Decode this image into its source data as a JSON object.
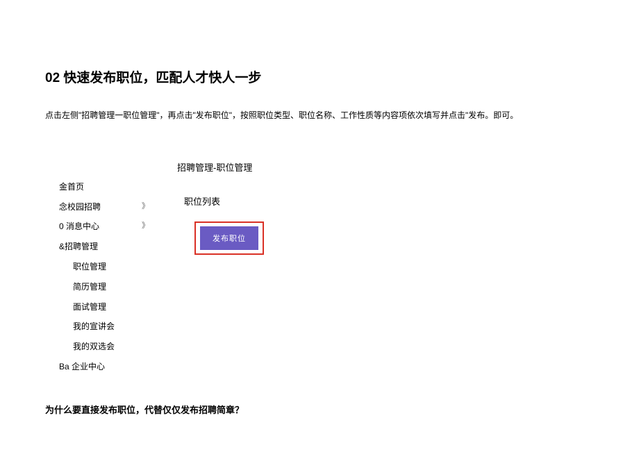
{
  "heading": {
    "num": "02",
    "text": "快速发布职位，匹配人才快人一步"
  },
  "instruction": "点击左侧\"招聘管理一职位管理\"，再点击\"发布职位\"，按照职位类型、职位名称、工作性质等内容项依次填写并点击\"发布。即可。",
  "sidebar": {
    "items": [
      {
        "label": "金首页",
        "expand": "",
        "sub": false
      },
      {
        "label": "念校园招聘",
        "expand": "》",
        "sub": false
      },
      {
        "label": "0 消息中心",
        "expand": "》",
        "sub": false
      },
      {
        "label": "&招聘管理",
        "expand": "",
        "sub": false
      },
      {
        "label": "职位管理",
        "expand": "",
        "sub": true
      },
      {
        "label": "简历管理",
        "expand": "",
        "sub": true
      },
      {
        "label": "面试管理",
        "expand": "",
        "sub": true
      },
      {
        "label": "我的宣讲会",
        "expand": "",
        "sub": true
      },
      {
        "label": "我的双选会",
        "expand": "",
        "sub": true
      },
      {
        "label": "Ba 企业中心",
        "expand": "",
        "sub": false
      }
    ]
  },
  "main": {
    "breadcrumb": "招聘管理-职位管理",
    "list_title": "职位列表",
    "publish_button": "发布职位"
  },
  "question": "为什么要直接发布职位，代替仅仅发布招聘简章？"
}
